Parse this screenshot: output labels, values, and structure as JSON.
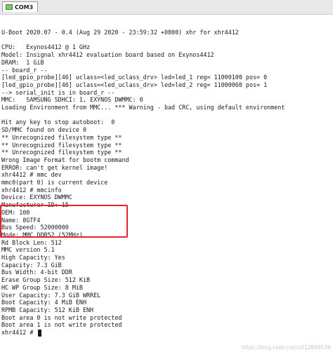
{
  "tab": {
    "label": "COM3"
  },
  "terminal": {
    "lines": [
      "U-Boot 2020.07 - 0.4 (Aug 29 2020 - 23:59:32 +0800) xhr for xhr4412",
      "",
      "CPU:   Exynos4412 @ 1 GHz",
      "Model: Insignal xhr4412 evaluation board based on Exynos4412",
      "DRAM:  1 GiB",
      "-- board_r --",
      "[led_gpio_probe][46] uclass=<led_uclass_drv> led=led_1 reg= 11000100 pos= 0",
      "[led_gpio_probe][46] uclass=<led_uclass_drv> led=led_2 reg= 11000060 pos= 1",
      "--> serial_init is in board_r --",
      "MMC:   SAMSUNG SDHCI: 1, EXYNOS DWMMC: 0",
      "Loading Environment from MMC... *** Warning - bad CRC, using default environment",
      "",
      "Hit any key to stop autoboot:  0",
      "SD/MMC found on device 0",
      "** Unrecognized filesystem type **",
      "** Unrecognized filesystem type **",
      "** Unrecognized filesystem type **",
      "Wrong Image Format for bootm command",
      "ERROR: can't get kernel image!",
      "xhr4412 # mmc dev",
      "mmc0(part 0) is current device",
      "xhr4412 # mmcinfo",
      "Device: EXYNOS DWMMC",
      "Manufacturer ID: 15",
      "OEM: 100",
      "Name: 8GTF4",
      "Bus Speed: 52000000",
      "Mode: MMC DDR52 (52MHz)",
      "Rd Block Len: 512",
      "MMC version 5.1",
      "High Capacity: Yes",
      "Capacity: 7.3 GiB",
      "Bus Width: 4-bit DDR",
      "Erase Group Size: 512 KiB",
      "HC WP Group Size: 8 MiB",
      "User Capacity: 7.3 GiB WRREL",
      "Boot Capacity: 4 MiB ENH",
      "RPMB Capacity: 512 KiB ENH",
      "Boot area 0 is not write protected",
      "Boot area 1 is not write protected",
      "xhr4412 # "
    ]
  },
  "watermark": "https://blog.csdn.net/u012849539",
  "colors": {
    "highlight": "#e8242b",
    "text": "#1a1a1a",
    "background": "#ffffff"
  }
}
